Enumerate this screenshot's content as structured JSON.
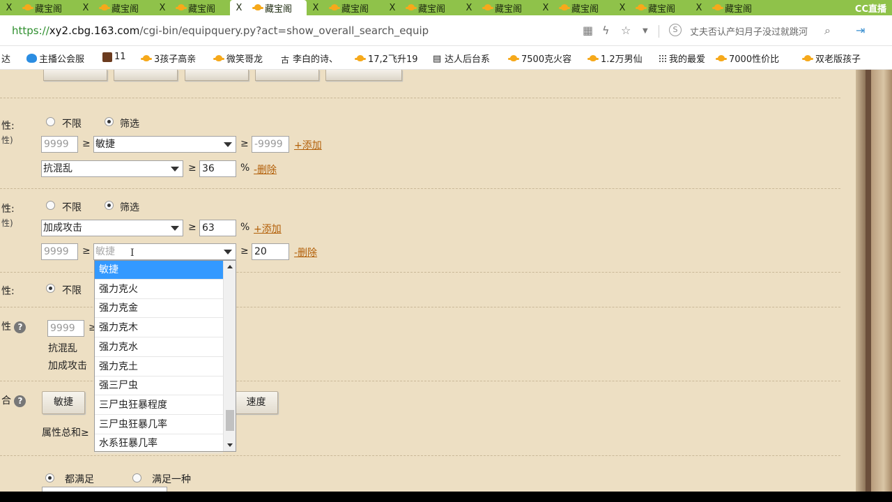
{
  "browser": {
    "tabs": [
      {
        "label": "藏宝阁",
        "active": false
      },
      {
        "label": "藏宝阁",
        "active": false
      },
      {
        "label": "藏宝阁",
        "active": false
      },
      {
        "label": "藏宝阁",
        "active": true
      },
      {
        "label": "藏宝阁",
        "active": false
      },
      {
        "label": "藏宝阁",
        "active": false
      },
      {
        "label": "藏宝阁",
        "active": false
      },
      {
        "label": "藏宝阁",
        "active": false
      },
      {
        "label": "藏宝阁",
        "active": false
      },
      {
        "label": "藏宝阁",
        "active": false
      }
    ],
    "close_glyph": "X",
    "cc_logo": "CC直播",
    "url_scheme": "https://",
    "url_host": "xy2.cbg.163.com",
    "url_path": "/cgi-bin/equipquery.py?act=show_overall_search_equip",
    "search_placeholder": "丈夫否认产妇月子没过就跳河",
    "search_s": "S",
    "icons": [
      "qr-icon",
      "lightning-icon",
      "star-icon",
      "dropdown-icon",
      "search-icon",
      "login-icon"
    ],
    "bookmarks": [
      {
        "label": "达",
        "icon": "none"
      },
      {
        "label": "主播公会服",
        "icon": "blue-bird-icon"
      },
      {
        "label": "11",
        "icon": "square-icon"
      },
      {
        "label": "3孩子高亲",
        "icon": "cbg-icon"
      },
      {
        "label": "微笑哥龙",
        "icon": "cbg-icon"
      },
      {
        "label": "李白的诗、",
        "icon": "ancient-icon"
      },
      {
        "label": "17,2飞升19",
        "icon": "cbg-icon"
      },
      {
        "label": "达人后台系",
        "icon": "doc-icon"
      },
      {
        "label": "7500克火容",
        "icon": "cbg-icon"
      },
      {
        "label": "1.2万男仙",
        "icon": "cbg-icon"
      },
      {
        "label": "我的最爱",
        "icon": "grid-icon"
      },
      {
        "label": "7000性价比",
        "icon": "cbg-icon"
      },
      {
        "label": "双老版孩子",
        "icon": "cbg-icon"
      }
    ]
  },
  "form": {
    "section1": {
      "label": "性:",
      "sub": "性)",
      "radio_unlimited": "不限",
      "radio_filter": "筛选",
      "filter_checked": true,
      "row1": {
        "min_ph": "9999",
        "ge": "≥",
        "attr": "敏捷",
        "ge2": "≥",
        "value_ph": "-9999",
        "action": "+添加"
      },
      "row2": {
        "attr": "抗混乱",
        "ge": "≥",
        "value": "36",
        "unit": "%",
        "action": "-删除"
      }
    },
    "section2": {
      "label": "性:",
      "sub": "性)",
      "radio_unlimited": "不限",
      "radio_filter": "筛选",
      "filter_checked": true,
      "row1": {
        "attr": "加成攻击",
        "ge": "≥",
        "value": "63",
        "unit": "%",
        "action": "+添加"
      },
      "row2": {
        "min_ph": "9999",
        "ge": "≥",
        "attr_ph": "敏捷",
        "ge2": "≥",
        "value": "20",
        "action": "-删除"
      }
    },
    "section3": {
      "label": "性:",
      "radio_unlimited": "不限"
    },
    "section4": {
      "label": "性",
      "help": "?",
      "min_ph": "9999",
      "ge": "≥",
      "line1": "抗混乱",
      "line2": "加成攻击"
    },
    "section5": {
      "label": "合",
      "help": "?",
      "btn1": "敏捷",
      "btn2": "速度",
      "sum_label": "属性总和≥"
    },
    "section6": {
      "radio_all": "都满足",
      "radio_one": "满足一种",
      "all_checked": true
    },
    "dropdown": {
      "items": [
        "敏捷",
        "强力克火",
        "强力克金",
        "强力克木",
        "强力克水",
        "强力克土",
        "强三尸虫",
        "三尸虫狂暴程度",
        "三尸虫狂暴几率",
        "水系狂暴几率"
      ],
      "selected_index": 0
    }
  }
}
